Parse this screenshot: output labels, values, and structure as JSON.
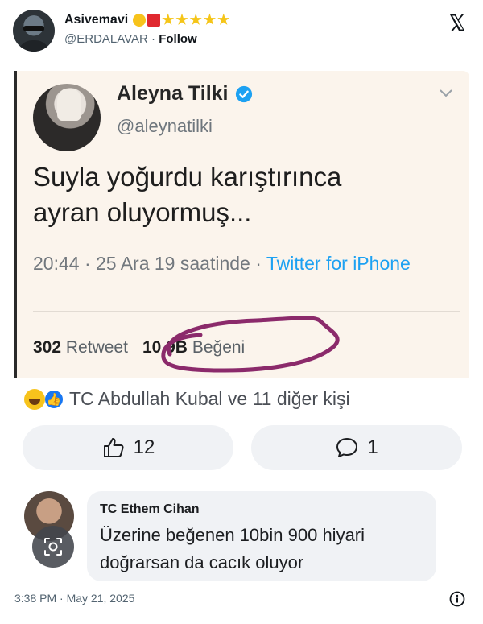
{
  "outer": {
    "name": "Asivemavi",
    "handle": "@ERDALAVAR",
    "separator": " · ",
    "follow": "Follow",
    "timestamp": "3:38 PM · May 21, 2025"
  },
  "inner_tweet": {
    "name": "Aleyna Tilki",
    "handle": "@aleynatilki",
    "text_line1": "Suyla yoğurdu karıştırınca",
    "text_line2": "ayran oluyormuş...",
    "meta_time": "20:44 · 25 Ara 19 saatinde · ",
    "meta_source": "Twitter for iPhone",
    "retweet_count": "302",
    "retweet_label": "Retweet",
    "like_count": "10,9B",
    "like_label": "Beğeni"
  },
  "facebook": {
    "reactions_text": "TC Abdullah Kubal ve 11 diğer kişi",
    "like_count": "12",
    "comment_count": "1",
    "comment": {
      "author": "TC Ethem Cihan",
      "line1": "Üzerine beğenen 10bin 900 hiyari",
      "line2": "doğrarsan da cacık oluyor"
    }
  },
  "colors": {
    "link_blue": "#1da1f2",
    "circle_marker": "#8b2a6b",
    "card_bg": "#fbf4ec"
  },
  "icons": [
    "x-logo-icon",
    "verified-badge-icon",
    "chevron-down-icon",
    "like-thumb-icon",
    "comment-bubble-icon",
    "lens-icon",
    "info-icon"
  ]
}
